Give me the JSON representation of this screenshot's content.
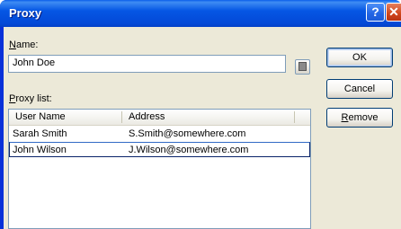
{
  "window": {
    "title": "Proxy",
    "help_glyph": "?",
    "close_glyph": "✕"
  },
  "name": {
    "label_prefix": "N",
    "label_rest": "ame:",
    "value": "John Doe"
  },
  "proxy_list": {
    "label_prefix": "P",
    "label_rest": "roxy list:",
    "columns": [
      "User Name",
      "Address"
    ],
    "rows": [
      {
        "user": "Sarah Smith",
        "address": "S.Smith@somewhere.com"
      },
      {
        "user": "John Wilson",
        "address": "J.Wilson@somewhere.com"
      }
    ]
  },
  "buttons": {
    "ok": "OK",
    "cancel": "Cancel",
    "remove_prefix": "R",
    "remove_rest": "emove"
  },
  "colors": {
    "titlebar": "#0054e3",
    "client": "#ece9d8",
    "border": "#7f9db9"
  }
}
